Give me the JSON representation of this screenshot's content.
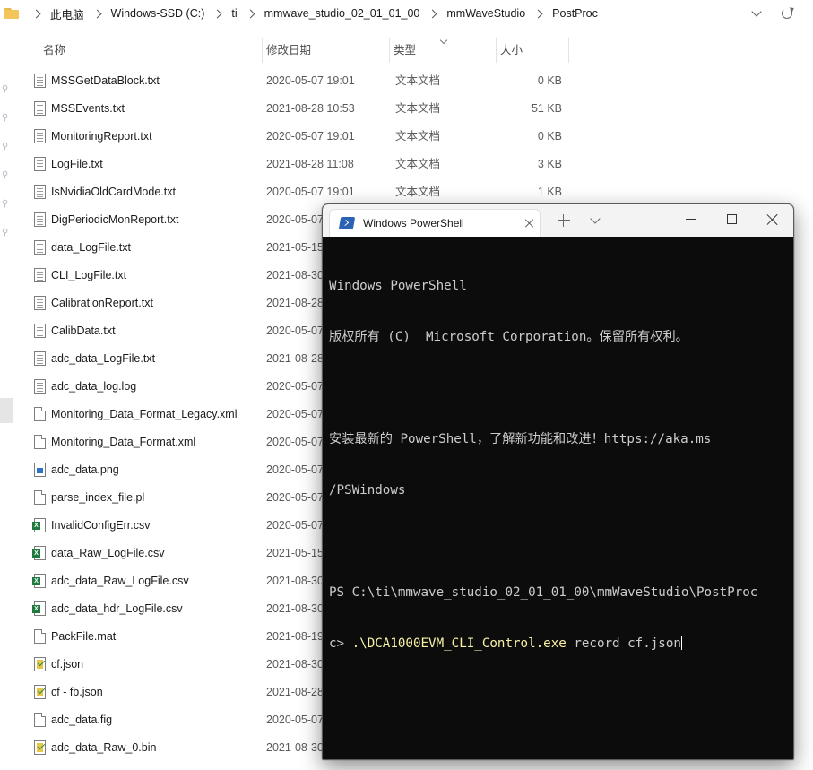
{
  "address_bar": {
    "crumbs": [
      "此电脑",
      "Windows-SSD (C:)",
      "ti",
      "mmwave_studio_02_01_01_00",
      "mmWaveStudio",
      "PostProc"
    ]
  },
  "columns": {
    "name": "名称",
    "date": "修改日期",
    "type": "类型",
    "size": "大小"
  },
  "files": [
    {
      "name": "MSSGetDataBlock.txt",
      "icon": "txt",
      "date": "2020-05-07 19:01",
      "type": "文本文档",
      "size": "0 KB"
    },
    {
      "name": "MSSEvents.txt",
      "icon": "txt",
      "date": "2021-08-28 10:53",
      "type": "文本文档",
      "size": "51 KB"
    },
    {
      "name": "MonitoringReport.txt",
      "icon": "txt",
      "date": "2020-05-07 19:01",
      "type": "文本文档",
      "size": "0 KB"
    },
    {
      "name": "LogFile.txt",
      "icon": "txt",
      "date": "2021-08-28 11:08",
      "type": "文本文档",
      "size": "3 KB"
    },
    {
      "name": "IsNvidiaOldCardMode.txt",
      "icon": "txt",
      "date": "2020-05-07 19:01",
      "type": "文本文档",
      "size": "1 KB"
    },
    {
      "name": "DigPeriodicMonReport.txt",
      "icon": "txt",
      "date": "2020-05-07",
      "type": "",
      "size": ""
    },
    {
      "name": "data_LogFile.txt",
      "icon": "txt",
      "date": "2021-05-15",
      "type": "",
      "size": ""
    },
    {
      "name": "CLI_LogFile.txt",
      "icon": "txt",
      "date": "2021-08-30",
      "type": "",
      "size": ""
    },
    {
      "name": "CalibrationReport.txt",
      "icon": "txt",
      "date": "2021-08-28",
      "type": "",
      "size": ""
    },
    {
      "name": "CalibData.txt",
      "icon": "txt",
      "date": "2020-05-07",
      "type": "",
      "size": ""
    },
    {
      "name": "adc_data_LogFile.txt",
      "icon": "txt",
      "date": "2021-08-28",
      "type": "",
      "size": ""
    },
    {
      "name": "adc_data_log.log",
      "icon": "txt",
      "date": "2020-05-07",
      "type": "",
      "size": ""
    },
    {
      "name": "Monitoring_Data_Format_Legacy.xml",
      "icon": "blank",
      "date": "2020-05-07",
      "type": "",
      "size": ""
    },
    {
      "name": "Monitoring_Data_Format.xml",
      "icon": "blank",
      "date": "2020-05-07",
      "type": "",
      "size": ""
    },
    {
      "name": "adc_data.png",
      "icon": "png",
      "date": "2020-05-07",
      "type": "",
      "size": ""
    },
    {
      "name": "parse_index_file.pl",
      "icon": "blank",
      "date": "2020-05-07",
      "type": "",
      "size": ""
    },
    {
      "name": "InvalidConfigErr.csv",
      "icon": "csv",
      "date": "2020-05-07",
      "type": "",
      "size": ""
    },
    {
      "name": "data_Raw_LogFile.csv",
      "icon": "csv",
      "date": "2021-05-15",
      "type": "",
      "size": ""
    },
    {
      "name": "adc_data_Raw_LogFile.csv",
      "icon": "csv",
      "date": "2021-08-30",
      "type": "",
      "size": ""
    },
    {
      "name": "adc_data_hdr_LogFile.csv",
      "icon": "csv",
      "date": "2021-08-30",
      "type": "",
      "size": ""
    },
    {
      "name": "PackFile.mat",
      "icon": "blank",
      "date": "2021-08-19",
      "type": "",
      "size": ""
    },
    {
      "name": "cf.json",
      "icon": "json",
      "date": "2021-08-30",
      "type": "",
      "size": ""
    },
    {
      "name": "cf - fb.json",
      "icon": "json",
      "date": "2021-08-28",
      "type": "",
      "size": ""
    },
    {
      "name": "adc_data.fig",
      "icon": "blank",
      "date": "2020-05-07",
      "type": "",
      "size": ""
    },
    {
      "name": "adc_data_Raw_0.bin",
      "icon": "json",
      "date": "2021-08-30",
      "type": "",
      "size": ""
    }
  ],
  "powershell": {
    "tab_title": "Windows PowerShell",
    "lines": [
      "Windows PowerShell",
      "版权所有 (C)  Microsoft Corporation。保留所有权利。",
      "",
      "安装最新的 PowerShell，了解新功能和改进！https://aka.ms",
      "/PSWindows",
      "",
      "PS C:\\ti\\mmwave_studio_02_01_01_00\\mmWaveStudio\\PostProc"
    ],
    "prompt_tail": "c> ",
    "command": ".\\DCA1000EVM_CLI_Control.exe",
    "args": " record cf.json"
  }
}
